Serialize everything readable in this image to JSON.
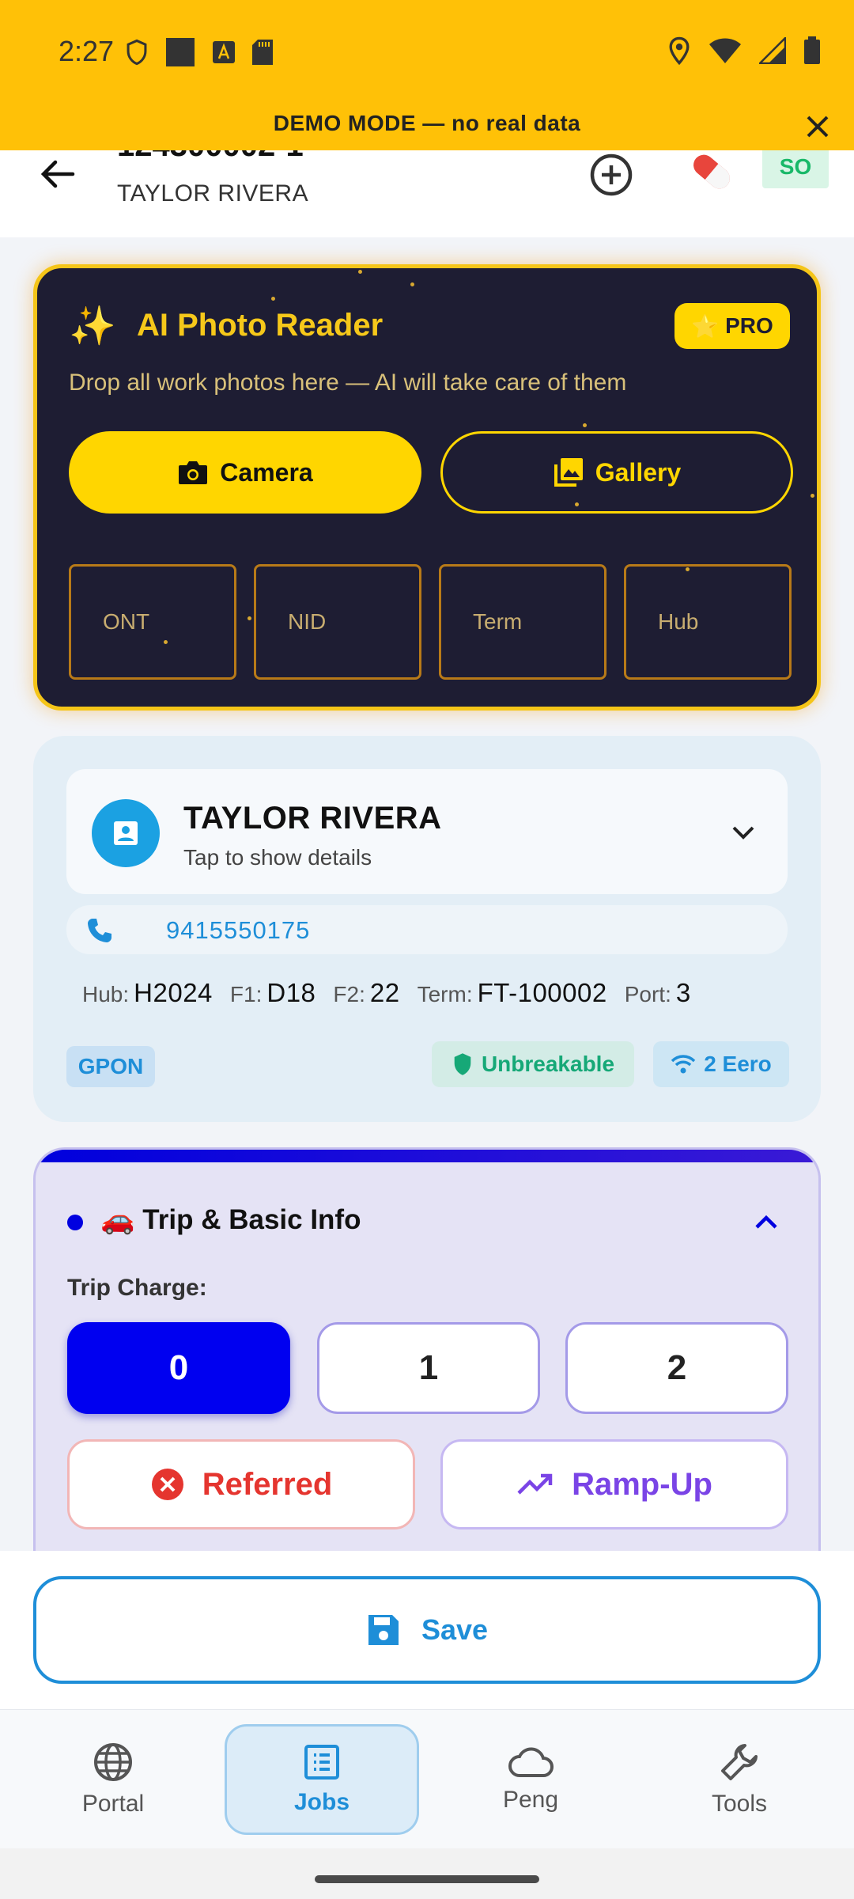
{
  "status_bar": {
    "time": "2:27"
  },
  "banner": {
    "text": "DEMO MODE — no real data"
  },
  "header": {
    "job_id": "124300002-1",
    "customer": "TAYLOR RIVERA",
    "so_badge": "SO"
  },
  "ai_reader": {
    "title": "AI Photo Reader",
    "pro_label": "PRO",
    "description": "Drop all work photos here — AI will take care of them",
    "camera_label": "Camera",
    "gallery_label": "Gallery",
    "slots": [
      "ONT",
      "NID",
      "Term",
      "Hub"
    ]
  },
  "customer": {
    "name": "TAYLOR RIVERA",
    "tap_hint": "Tap to show details",
    "phone": "9415550175",
    "hub_label": "Hub:",
    "hub": "H2024",
    "f1_label": "F1:",
    "f1": "D18",
    "f2_label": "F2:",
    "f2": "22",
    "term_label": "Term:",
    "term": "FT-100002",
    "port_label": "Port:",
    "port": "3",
    "badges": {
      "gpon": "GPON",
      "unbreakable": "Unbreakable",
      "eero": "2 Eero"
    }
  },
  "trip": {
    "title": "🚗 Trip & Basic Info",
    "charge_label": "Trip Charge:",
    "options": [
      "0",
      "1",
      "2"
    ],
    "selected": "0",
    "referred_label": "Referred",
    "rampup_label": "Ramp-Up"
  },
  "save": {
    "label": "Save"
  },
  "nav": {
    "items": [
      "Portal",
      "Jobs",
      "Peng",
      "Tools"
    ],
    "active": "Jobs"
  },
  "colors": {
    "accent": "#1e8ed8",
    "banner": "#ffc107",
    "trip_primary": "#0000f0",
    "ai_gold": "#ffd600"
  }
}
